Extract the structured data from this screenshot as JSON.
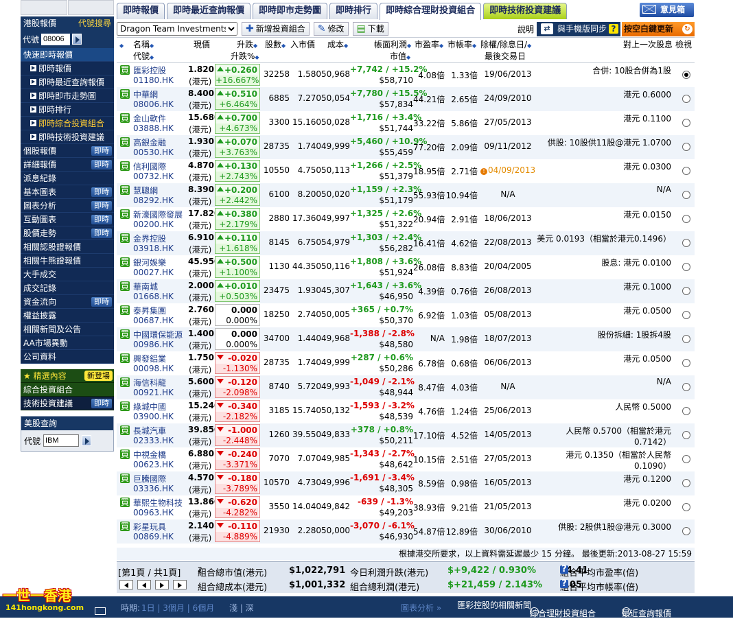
{
  "tabs": [
    "即時報價",
    "即時最近查詢報價",
    "即時即市走勢圖",
    "即時排行",
    "即時綜合理財投資組合",
    "即時技術投資建議"
  ],
  "feedback_label": "意見箱",
  "sidebar": {
    "hk_header": "港股報價",
    "hk_search": "代號搜尋",
    "code_label": "代號",
    "code_value": "08006",
    "quick_header": "快速即時報價",
    "sub_items": [
      "即時報價",
      "即時最近查詢報價",
      "即時即市走勢圖",
      "即時排行",
      "即時綜合投資組合",
      "即時技術投資建議"
    ],
    "items": [
      {
        "label": "個股報價",
        "badge": "即時"
      },
      {
        "label": "詳細報價",
        "badge": "即時"
      },
      {
        "label": "派息紀錄",
        "badge": ""
      },
      {
        "label": "基本圖表",
        "badge": "即時"
      },
      {
        "label": "圖表分析",
        "badge": "即時"
      },
      {
        "label": "互動圖表",
        "badge": "即時"
      },
      {
        "label": "股價走勢",
        "badge": "即時"
      },
      {
        "label": "相關認股證報價",
        "badge": ""
      },
      {
        "label": "相關牛熊證報價",
        "badge": ""
      },
      {
        "label": "大手成交",
        "badge": ""
      },
      {
        "label": "成交記錄",
        "badge": ""
      },
      {
        "label": "資金流向",
        "badge": "即時"
      },
      {
        "label": "權益披露",
        "badge": ""
      },
      {
        "label": "相關新聞及公告",
        "badge": ""
      },
      {
        "label": "AA市場異動",
        "badge": ""
      },
      {
        "label": "公司資料",
        "badge": ""
      }
    ],
    "promo_title": "★ 精選內容",
    "promo_badge": "新登場",
    "promo_item1": "綜合投資組合",
    "promo_item2": "技術投資建議",
    "promo_item2_badge": "即時",
    "us_header": "美股查詢",
    "us_code_label": "代號",
    "us_code_value": "IBM"
  },
  "toolbar": {
    "portfolio": "Dragon Team Investments",
    "add": "新增投資組合",
    "edit": "修改",
    "download": "下載",
    "help": "說明",
    "sync": "與手機版同步",
    "update": "按空白鍵更新"
  },
  "headers": {
    "name": "名稱",
    "code": "代號",
    "price": "現價",
    "chg": "升跌",
    "chgp": "升跌%",
    "shares": "股數",
    "entry": "入市價",
    "cost": "成本",
    "pl": "帳面利潤",
    "mv": "市值",
    "pe": "市盈率",
    "pb": "市帳率",
    "exdate": "除權/除息日/",
    "lasttrade": "最後交易日",
    "dividend": "對上一次股息",
    "select": "檢視"
  },
  "currency_label": "(港元)",
  "buy_label": "買",
  "rows": [
    {
      "name": "匯彩控股",
      "code": "01180.HK",
      "price": "1.820",
      "chg": "+0.260",
      "chgp": "+16.667%",
      "dir": "up",
      "shares": "32258",
      "entry": "1.580",
      "cost": "50,968",
      "pl": "+7,742 / +15.2%",
      "mv": "$58,710",
      "pe": "4.08倍",
      "pb": "1.33倍",
      "date": "19/06/2013",
      "div1": "合併: 10股合併為1股",
      "div2": "",
      "sel": true
    },
    {
      "name": "中華網",
      "code": "08006.HK",
      "price": "8.400",
      "chg": "+0.510",
      "chgp": "+6.464%",
      "dir": "up",
      "shares": "6885",
      "entry": "7.270",
      "cost": "50,054",
      "pl": "+7,780 / +15.5%",
      "mv": "$57,834",
      "pe": "44.21倍",
      "pb": "2.65倍",
      "date": "24/09/2010",
      "div1": "港元 0.6000",
      "div2": ""
    },
    {
      "name": "金山軟件",
      "code": "03888.HK",
      "price": "15.680",
      "chg": "+0.700",
      "chgp": "+4.673%",
      "dir": "up",
      "shares": "3300",
      "entry": "15.160",
      "cost": "50,028",
      "pl": "+1,716 / +3.4%",
      "mv": "$51,744",
      "pe": "33.22倍",
      "pb": "5.86倍",
      "date": "27/05/2013",
      "div1": "港元 0.1100",
      "div2": ""
    },
    {
      "name": "高銀金融",
      "code": "00530.HK",
      "price": "1.930",
      "chg": "+0.070",
      "chgp": "+3.763%",
      "dir": "up",
      "shares": "28735",
      "entry": "1.740",
      "cost": "49,999",
      "pl": "+5,460 / +10.9%",
      "mv": "$55,459",
      "pe": "77.20倍",
      "pb": "2.09倍",
      "date": "09/11/2012",
      "div1": "供股: 10股供11股@港元 1.0700",
      "div2": ""
    },
    {
      "name": "信利國際",
      "code": "00732.HK",
      "price": "4.870",
      "chg": "+0.130",
      "chgp": "+2.743%",
      "dir": "up",
      "shares": "10550",
      "entry": "4.750",
      "cost": "50,113",
      "pl": "+1,266 / +2.5%",
      "mv": "$51,379",
      "pe": "18.95倍",
      "pb": "2.71倍",
      "date": "04/09/2013",
      "warn": true,
      "div1": "港元 0.0300",
      "div2": ""
    },
    {
      "name": "慧聰網",
      "code": "08292.HK",
      "price": "8.390",
      "chg": "+0.200",
      "chgp": "+2.442%",
      "dir": "up",
      "shares": "6100",
      "entry": "8.200",
      "cost": "50,020",
      "pl": "+1,159 / +2.3%",
      "mv": "$51,179",
      "pe": "55.93倍",
      "pb": "10.94倍",
      "date": "N/A",
      "div1": "N/A",
      "div2": ""
    },
    {
      "name": "新濠國際發展",
      "code": "00200.HK",
      "price": "17.820",
      "chg": "+0.380",
      "chgp": "+2.179%",
      "dir": "up",
      "shares": "2880",
      "entry": "17.360",
      "cost": "49,997",
      "pl": "+1,325 / +2.6%",
      "mv": "$51,322",
      "pe": "20.94倍",
      "pb": "2.91倍",
      "date": "18/06/2013",
      "div1": "港元 0.0150",
      "div2": ""
    },
    {
      "name": "金界控股",
      "code": "03918.HK",
      "price": "6.910",
      "chg": "+0.110",
      "chgp": "+1.618%",
      "dir": "up",
      "shares": "8145",
      "entry": "6.750",
      "cost": "54,979",
      "pl": "+1,303 / +2.4%",
      "mv": "$56,282",
      "pe": "16.41倍",
      "pb": "4.62倍",
      "date": "22/08/2013",
      "div1": "美元 0.0193（相當於港元0.1496）",
      "div2": ""
    },
    {
      "name": "銀河娛樂",
      "code": "00027.HK",
      "price": "45.950",
      "chg": "+0.500",
      "chgp": "+1.100%",
      "dir": "up",
      "shares": "1130",
      "entry": "44.350",
      "cost": "50,116",
      "pl": "+1,808 / +3.6%",
      "mv": "$51,924",
      "pe": "26.08倍",
      "pb": "8.83倍",
      "date": "20/04/2005",
      "div1": "股息: 港元 0.0100",
      "div2": ""
    },
    {
      "name": "華南城",
      "code": "01668.HK",
      "price": "2.000",
      "chg": "+0.010",
      "chgp": "+0.503%",
      "dir": "up",
      "shares": "23475",
      "entry": "1.930",
      "cost": "45,307",
      "pl": "+1,643 / +3.6%",
      "mv": "$46,950",
      "pe": "4.39倍",
      "pb": "0.76倍",
      "date": "26/08/2013",
      "div1": "港元 0.1000",
      "div2": ""
    },
    {
      "name": "泰昇集團",
      "code": "00687.HK",
      "price": "2.760",
      "chg": "0.000",
      "chgp": "0.000%",
      "dir": "flat",
      "shares": "18250",
      "entry": "2.740",
      "cost": "50,005",
      "pl": "+365 / +0.7%",
      "mv": "$50,370",
      "pe": "6.92倍",
      "pb": "1.03倍",
      "date": "05/08/2013",
      "div1": "港元 0.0500",
      "div2": ""
    },
    {
      "name": "中國環保能源",
      "code": "00986.HK",
      "price": "1.400",
      "chg": "0.000",
      "chgp": "0.000%",
      "dir": "flat",
      "shares": "34700",
      "entry": "1.440",
      "cost": "49,968",
      "pl": "-1,388 / -2.8%",
      "mv": "$48,580",
      "pe": "N/A",
      "pb": "1.98倍",
      "date": "18/07/2013",
      "div1": "股份拆細: 1股拆4股",
      "div2": ""
    },
    {
      "name": "興發鋁業",
      "code": "00098.HK",
      "price": "1.750",
      "chg": "-0.020",
      "chgp": "-1.130%",
      "dir": "down",
      "shares": "28735",
      "entry": "1.740",
      "cost": "49,999",
      "pl": "+287 / +0.6%",
      "mv": "$50,286",
      "pe": "6.78倍",
      "pb": "0.68倍",
      "date": "06/06/2013",
      "div1": "港元 0.0500",
      "div2": ""
    },
    {
      "name": "海信科龍",
      "code": "00921.HK",
      "price": "5.600",
      "chg": "-0.120",
      "chgp": "-2.098%",
      "dir": "down",
      "shares": "8740",
      "entry": "5.720",
      "cost": "49,993",
      "pl": "-1,049 / -2.1%",
      "mv": "$48,944",
      "pe": "8.47倍",
      "pb": "4.03倍",
      "date": "N/A",
      "div1": "N/A",
      "div2": ""
    },
    {
      "name": "綠城中國",
      "code": "03900.HK",
      "price": "15.240",
      "chg": "-0.340",
      "chgp": "-2.182%",
      "dir": "down",
      "shares": "3185",
      "entry": "15.740",
      "cost": "50,132",
      "pl": "-1,593 / -3.2%",
      "mv": "$48,539",
      "pe": "4.76倍",
      "pb": "1.24倍",
      "date": "25/06/2013",
      "div1": "人民幣 0.5000",
      "div2": ""
    },
    {
      "name": "長城汽車",
      "code": "02333.HK",
      "price": "39.850",
      "chg": "-1.000",
      "chgp": "-2.448%",
      "dir": "down",
      "shares": "1260",
      "entry": "39.550",
      "cost": "49,833",
      "pl": "+378 / +0.8%",
      "mv": "$50,211",
      "pe": "17.10倍",
      "pb": "4.52倍",
      "date": "14/05/2013",
      "div1": "人民幣 0.5700（相當於港元",
      "div2": "0.7142）"
    },
    {
      "name": "中視金橋",
      "code": "00623.HK",
      "price": "6.880",
      "chg": "-0.240",
      "chgp": "-3.371%",
      "dir": "down",
      "shares": "7070",
      "entry": "7.070",
      "cost": "49,985",
      "pl": "-1,343 / -2.7%",
      "mv": "$48,642",
      "pe": "10.15倍",
      "pb": "2.51倍",
      "date": "27/05/2013",
      "div1": "港元 0.1350（相當於人民幣",
      "div2": "0.1090）"
    },
    {
      "name": "巨騰國際",
      "code": "03336.HK",
      "price": "4.570",
      "chg": "-0.180",
      "chgp": "-3.789%",
      "dir": "down",
      "shares": "10570",
      "entry": "4.730",
      "cost": "49,996",
      "pl": "-1,691 / -3.4%",
      "mv": "$48,305",
      "pe": "8.59倍",
      "pb": "0.98倍",
      "date": "16/05/2013",
      "div1": "港元 0.1200",
      "div2": ""
    },
    {
      "name": "華熙生物科技",
      "code": "00963.HK",
      "price": "13.860",
      "chg": "-0.620",
      "chgp": "-4.282%",
      "dir": "down",
      "shares": "3550",
      "entry": "14.040",
      "cost": "49,842",
      "pl": "-639 / -1.3%",
      "mv": "$49,203",
      "pe": "38.93倍",
      "pb": "9.21倍",
      "date": "21/05/2013",
      "div1": "港元 0.0200",
      "div2": ""
    },
    {
      "name": "彩星玩具",
      "code": "00869.HK",
      "price": "2.140",
      "chg": "-0.110",
      "chgp": "-4.889%",
      "dir": "down",
      "shares": "21930",
      "entry": "2.280",
      "cost": "50,000",
      "pl": "-3,070 / -6.1%",
      "mv": "$46,930",
      "pe": "54.87倍",
      "pb": "12.89倍",
      "date": "30/06/2010",
      "div1": "供股: 2股供1股@港元 0.3000",
      "div2": ""
    }
  ],
  "note": "根據港交所要求，以上資料需延遲最少 15 分鐘。 最後更新:2013-08-27 15:59",
  "summary": {
    "page": "[第1頁 / 共1頁]",
    "mv_label": "組合總市值(港元)",
    "mv_sup": "2",
    "mv_value": "$1,022,791",
    "cost_label": "組合總成本(港元)",
    "cost_value": "$1,001,332",
    "day_label": "今日利潤升跌(港元)",
    "day_value": "$+9,422 / 0.930%",
    "total_label": "組合總利潤(港元)",
    "total_value": "$+21,459 / 2.143%",
    "pe_label": "組合平均市盈率(倍)",
    "pe_value": "24.41",
    "pb_label": "組合平均市帳率(倍)",
    "pb_value": "4.05"
  },
  "bottom": {
    "period_label": "時期:",
    "periods": "1日 | 3個月 | 6個月",
    "misc": "淺 | 深",
    "chart": "圖表分析 »",
    "related": "匯彩控股的相關新聞",
    "portfolio": "綜合理財投資組合",
    "recent": "最近查詢報價",
    "logo1": "一世一香港",
    "logo2": "141hongkong.com"
  }
}
